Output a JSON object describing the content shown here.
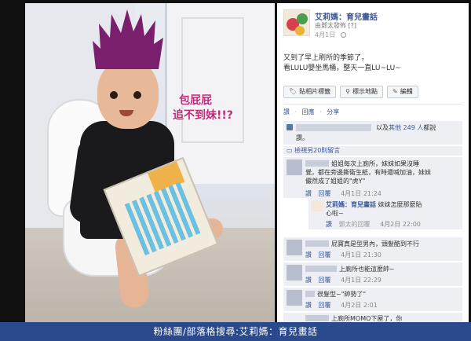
{
  "page": {
    "name": "艾莉媽：育兒畫話",
    "via": "由鄧太發佈 [?]",
    "date": "4月1日",
    "caption_lines": [
      "又到了早上刷所的季節了，",
      "看LULU嬰坐馬桶，整天一直LU~LU~"
    ]
  },
  "photo": {
    "bubble_line1": "包屁屁",
    "bubble_line2": "追不到妹!!?"
  },
  "actions": {
    "tag_photo": "貼相片標籤",
    "add_location": "標示地點",
    "edit": "編輯"
  },
  "links": {
    "like": "讚",
    "comment": "回應",
    "share": "分享"
  },
  "likes": {
    "text_prefix": "以及",
    "others": "其他",
    "count": "249 人",
    "suffix": "都說",
    "second_line": "讚。"
  },
  "more_comments": "檢視另20則留言",
  "comments": [
    {
      "lines": [
        "姐姐每次上廁所，妹妹如果沒睡",
        "覺，都在旁邊撕衛生紙，有時還喊加油，妹妹",
        "儼然成了姐姐的\"虎Y\""
      ],
      "like": "讚",
      "reply": "回覆",
      "time": "4月1日 21:24"
    },
    {
      "author": "艾莉媽：育兒畫話",
      "lines": [
        "妹妹怎麼那麼貼",
        "心啦~"
      ],
      "like": "讚",
      "reply": "鄧太的回覆",
      "time": "4月2日 22:00"
    },
    {
      "lines": [
        "屁寶真是型男內，頭髮酷到不行"
      ],
      "like": "讚",
      "reply": "回覆",
      "time": "4月1日 21:30"
    },
    {
      "lines": [
        "上廁所也能這麼帥~"
      ],
      "like": "讚",
      "reply": "回覆",
      "time": "4月1日 22:29"
    },
    {
      "lines": [
        "很髮型~\"帥勢了\""
      ],
      "like": "讚",
      "reply": "回覆",
      "time": "4月2日 2:01"
    }
  ],
  "partial_comment": "上廁所MOMO下屋了，你",
  "banner": "粉絲團/部落格搜尋:艾莉媽：育兒畫話",
  "colors": {
    "facebook_blue": "#3b5998",
    "banner": "#2b4a8e",
    "hair": "#7a1f6e",
    "bubble_text": "#c0287a"
  }
}
